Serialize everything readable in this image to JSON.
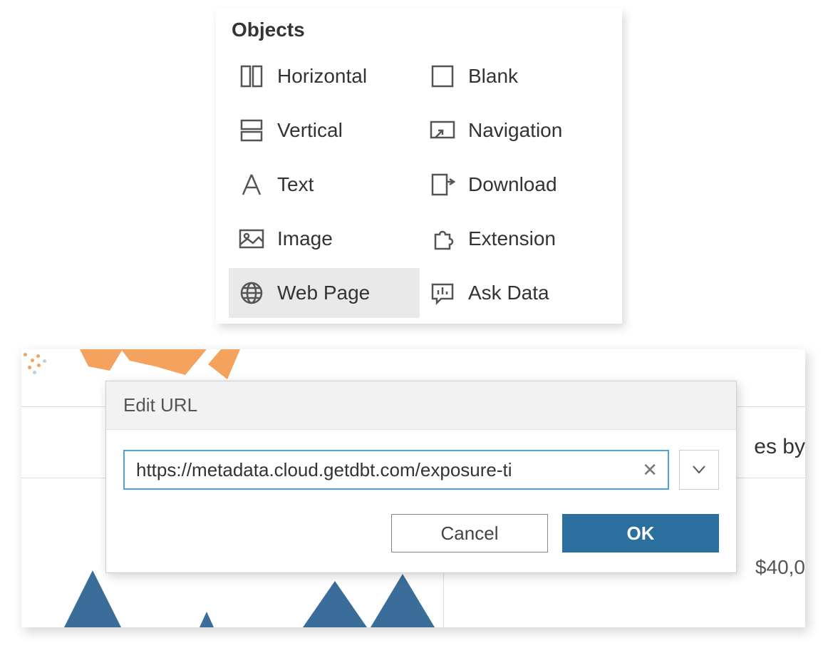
{
  "objects_panel": {
    "title": "Objects",
    "items": [
      {
        "id": "horizontal",
        "label": "Horizontal",
        "icon": "columns-icon"
      },
      {
        "id": "blank",
        "label": "Blank",
        "icon": "square-icon"
      },
      {
        "id": "vertical",
        "label": "Vertical",
        "icon": "rows-icon"
      },
      {
        "id": "navigation",
        "label": "Navigation",
        "icon": "navigation-icon"
      },
      {
        "id": "text",
        "label": "Text",
        "icon": "text-icon"
      },
      {
        "id": "download",
        "label": "Download",
        "icon": "download-icon"
      },
      {
        "id": "image",
        "label": "Image",
        "icon": "image-icon"
      },
      {
        "id": "extension",
        "label": "Extension",
        "icon": "puzzle-icon"
      },
      {
        "id": "webpage",
        "label": "Web Page",
        "icon": "globe-icon",
        "selected": true
      },
      {
        "id": "askdata",
        "label": "Ask Data",
        "icon": "chat-bar-icon"
      }
    ]
  },
  "dialog": {
    "title": "Edit URL",
    "url_value": "https://metadata.cloud.getdbt.com/exposure-ti",
    "cancel_label": "Cancel",
    "ok_label": "OK"
  },
  "background": {
    "right_text_fragment": "es by",
    "amount_fragment": "$40,0"
  }
}
